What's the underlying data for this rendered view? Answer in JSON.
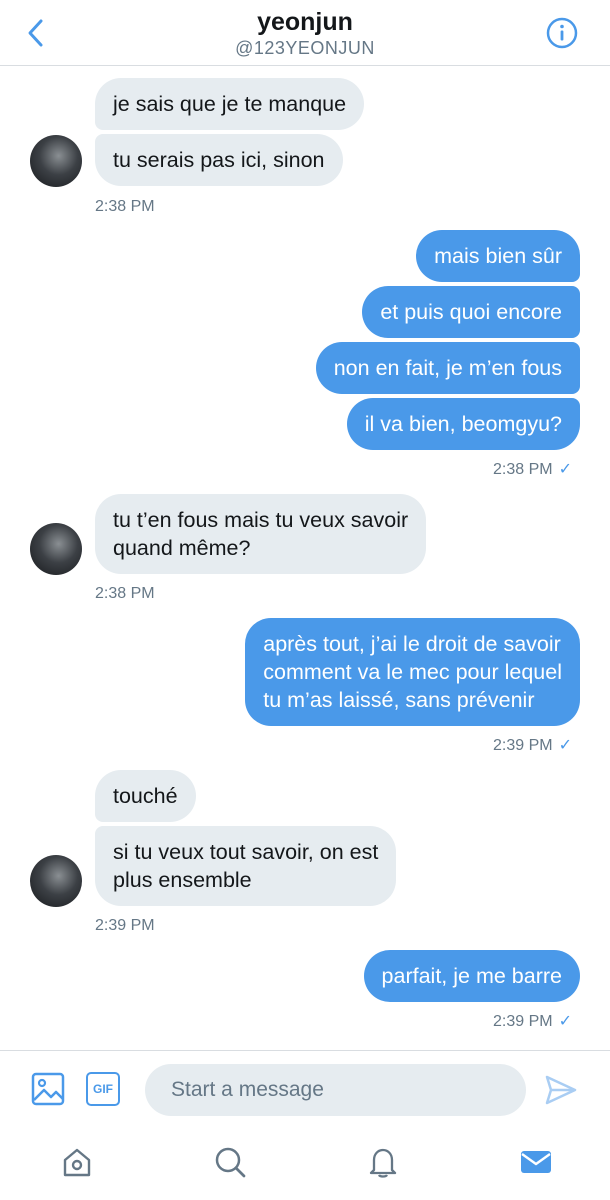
{
  "header": {
    "title": "yeonjun",
    "handle": "@123YEONJUN",
    "back_icon": "chevron-left-icon",
    "info_icon": "info-icon"
  },
  "messages": [
    {
      "from": "them",
      "text": "je sais que je te manque"
    },
    {
      "from": "them",
      "text": "tu serais pas ici, sinon"
    },
    {
      "time": "2:38 PM"
    },
    {
      "from": "me",
      "text": "mais bien sûr"
    },
    {
      "from": "me",
      "text": "et puis quoi encore"
    },
    {
      "from": "me",
      "text": "non en fait, je m’en fous"
    },
    {
      "from": "me",
      "text": "il va bien, beomgyu?"
    },
    {
      "time": "2:38 PM",
      "read": "✓"
    },
    {
      "from": "them",
      "line1": "tu t’en fous mais tu veux savoir",
      "line2": "quand même?"
    },
    {
      "time": "2:38 PM"
    },
    {
      "from": "me",
      "line1": "après tout, j’ai le droit de savoir",
      "line2": "comment va le mec pour lequel",
      "line3": "tu m’as laissé, sans prévenir"
    },
    {
      "time": "2:39 PM",
      "read": "✓"
    },
    {
      "from": "them",
      "text": "touché"
    },
    {
      "from": "them",
      "line1": "si tu veux tout savoir, on est",
      "line2": "plus ensemble"
    },
    {
      "time": "2:39 PM"
    },
    {
      "from": "me",
      "text": "parfait, je me barre"
    },
    {
      "time": "2:39 PM",
      "read": "✓"
    }
  ],
  "composer": {
    "placeholder": "Start a message",
    "gif_label": "GIF",
    "image_icon": "image-icon",
    "send_icon": "send-icon"
  },
  "tabbar": {
    "icons": [
      "home-icon",
      "search-icon",
      "notifications-icon",
      "messages-icon"
    ]
  },
  "colors": {
    "accent": "#4a99e9",
    "incoming_bubble": "#e6ecf0",
    "secondary_text": "#657786"
  }
}
